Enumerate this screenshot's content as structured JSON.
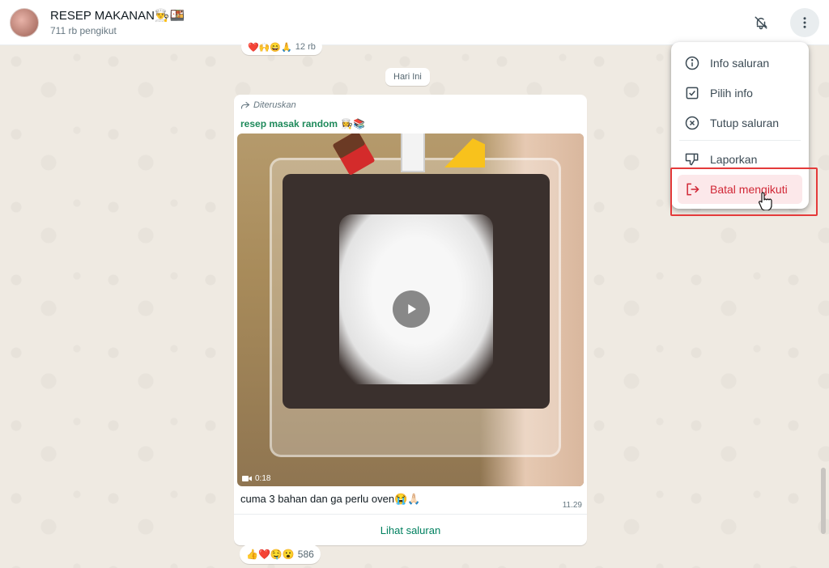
{
  "header": {
    "title": "RESEP MAKANAN👨‍🍳🍱",
    "subtitle": "711 rb pengikut"
  },
  "reactions_top": {
    "emojis": "❤️🙌😄🙏",
    "count": "12 rb"
  },
  "date_chip": "Hari Ini",
  "message": {
    "forwarded_label": "Diteruskan",
    "sender": "resep masak random",
    "sender_emoji": "👩‍🍳📚",
    "video_duration": "0:18",
    "caption": "cuma 3 bahan dan ga perlu oven😭🙏🏻",
    "time": "11.29",
    "view_channel": "Lihat saluran"
  },
  "reactions_bottom": {
    "emojis": "👍❤️🤤😮",
    "count": "586"
  },
  "menu": {
    "items": [
      {
        "label": "Info saluran",
        "icon": "info-icon"
      },
      {
        "label": "Pilih info",
        "icon": "checkbox-icon"
      },
      {
        "label": "Tutup saluran",
        "icon": "close-circle-icon"
      },
      {
        "label": "Laporkan",
        "icon": "thumbs-down-icon"
      },
      {
        "label": "Batal mengikuti",
        "icon": "exit-icon"
      }
    ]
  },
  "colors": {
    "accent_green": "#00805f",
    "sender_green": "#1f8a5b",
    "danger": "#d12736",
    "highlight_border": "#e43a3a"
  }
}
